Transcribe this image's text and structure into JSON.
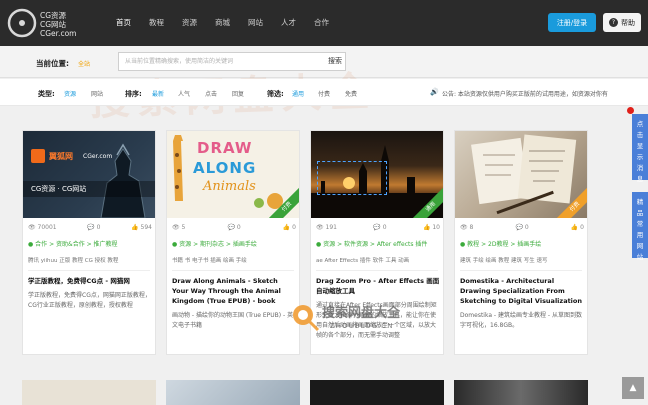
{
  "header": {
    "logo_line1": "CG资源",
    "logo_line2": "CG网站",
    "logo_line3": "CGer.com",
    "nav": [
      "首页",
      "教程",
      "资源",
      "商城",
      "网站",
      "人才",
      "合作"
    ],
    "login_label": "注册/登录",
    "help_label": "帮助"
  },
  "location": {
    "label": "当前位置:",
    "value": "全站"
  },
  "search": {
    "placeholder": "从当前位置精确搜索，使用简洁的关键词",
    "button": "搜索"
  },
  "filters": {
    "type_label": "类型:",
    "type_options": [
      "资源",
      "网站"
    ],
    "sort_label": "排序:",
    "sort_options": [
      "最新",
      "人气",
      "点击",
      "回复"
    ],
    "screen_label": "筛选:",
    "screen_options": [
      "通用",
      "付费",
      "免费"
    ],
    "notice_icon": "speaker-icon",
    "notice": "公告: 本站资源仅供用户购买正版前的试用用途，如资源对你有"
  },
  "cards": [
    {
      "stats": [
        "70001",
        "0",
        "594"
      ],
      "category": "合作 > 资助&合作 > 推广教程",
      "tags": "腾讯  yiihuu  正版  教程  CG  授权  教程",
      "title": "学正版教程，免费得CG点 - 网猫网",
      "desc": "学正版教程，免费得CG点，网猫网正版教程，CG行业正版教程，原创教程，授权教程",
      "badge": ""
    },
    {
      "stats": [
        "5",
        "0",
        "0"
      ],
      "category": "资源 > 期刊杂志 > 插画手绘",
      "tags": "书籍  书  电子书  插画  绘画  手绘",
      "title": "Draw Along Animals - Sketch Your Way Through the Animal Kingdom (True EPUB) - book",
      "desc": "画动物 - 描绘你的动物王国 (True EPUB) - 英文电子书籍",
      "badge": "付费"
    },
    {
      "stats": [
        "191",
        "0",
        "10"
      ],
      "category": "资源 > 软件资源 > After effects 插件",
      "tags": "ae  After Effects  插件  软件  工具  动画",
      "title": "Drag Zoom Pro - After Effects 画面自动缩放工具",
      "desc": "通过直接在After Effects画面部分周围绘制矩形来放大和缩小画面的缩放工具，能让你在使用自然后动画将画面缩放至一个区域，以放大帧的各个部分，而无需手动调整",
      "badge": "通用"
    },
    {
      "stats": [
        "8",
        "0",
        "0"
      ],
      "category": "教程 > 2D教程 > 插画手绘",
      "tags": "建筑  手绘  绘画  教程  建筑  写生  速写",
      "title": "Domestika - Architectural Drawing Specialization From Sketching to Digital Visualization",
      "desc": "Domestika - 建筑绘画专业教程 - 从草图到数字可视化，16.8GB。",
      "badge": "付费"
    }
  ],
  "thumb_texts": {
    "card1_brand": "翼狐网",
    "card1_domain": "CGer.com",
    "card1_caption": "CG资源 · CG网站",
    "card2_line1": "DRAW",
    "card2_line2": "ALONG",
    "card2_line3": "Animals"
  },
  "side": {
    "tab1": "点击显示消息",
    "tab2": "精品常用网站"
  },
  "watermark": "搜素网盘大全",
  "site_logo": "搜索网盘大全",
  "site_logo_sub": "ZHOUBLOG.CN",
  "colors": {
    "accent": "#1a9bdc",
    "header_bg": "#2b2b2b",
    "category_green": "#3bab3b",
    "badge_green": "#3aa33a",
    "badge_orange": "#f0a02a"
  }
}
